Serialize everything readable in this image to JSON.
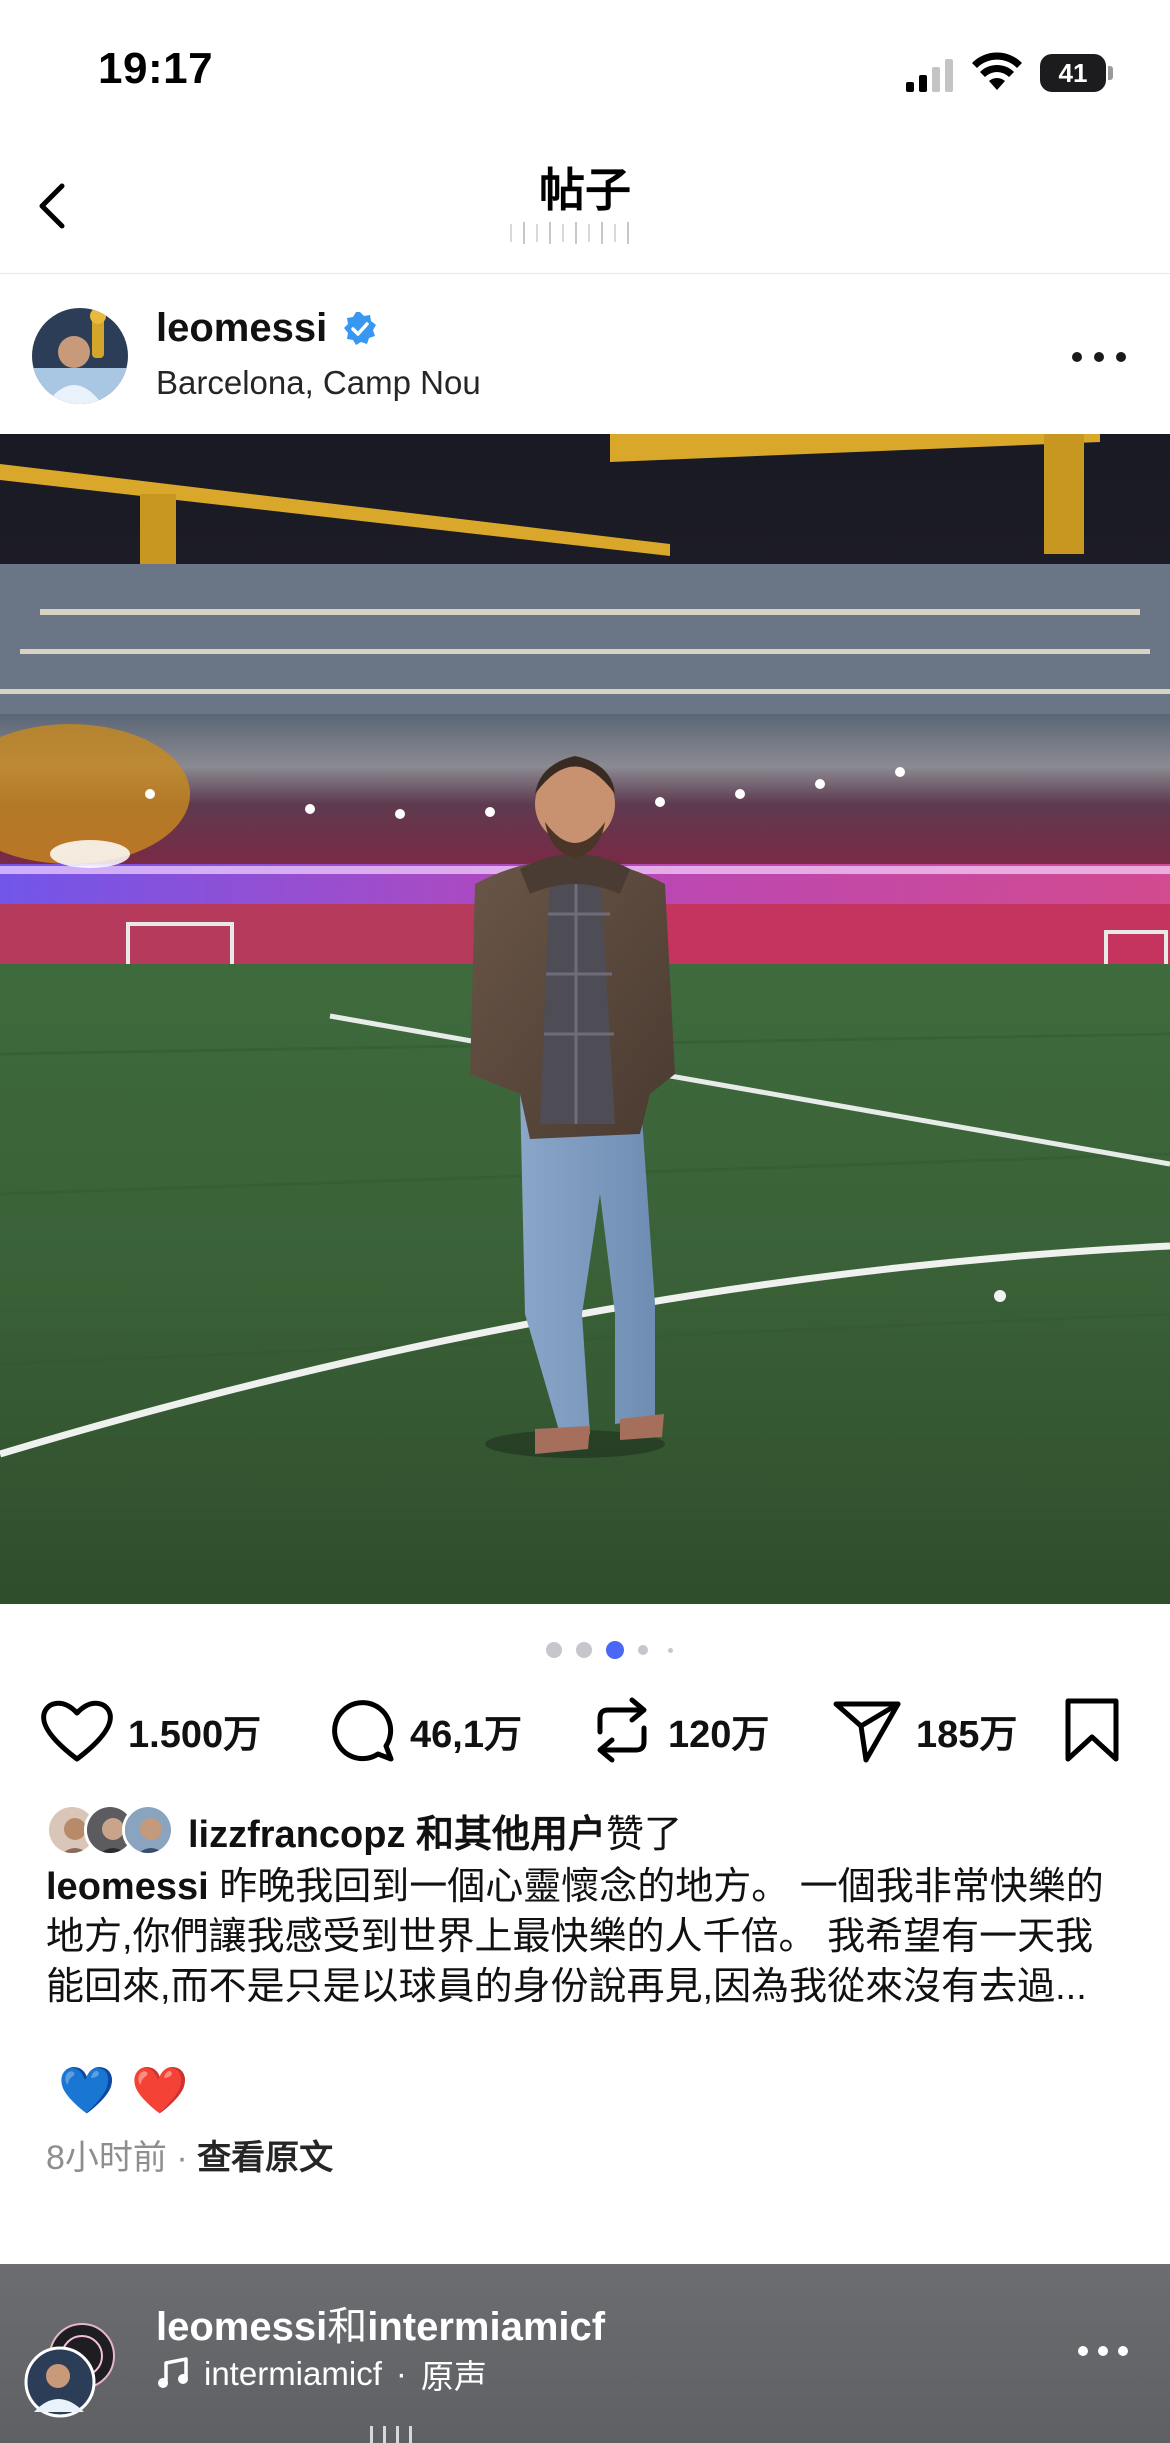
{
  "status_bar": {
    "time": "19:17",
    "battery": "41"
  },
  "header": {
    "title": "帖子"
  },
  "post": {
    "username": "leomessi",
    "location": "Barcelona, Camp Nou",
    "carousel": {
      "total": 5,
      "active": 3
    },
    "actions": {
      "likes": "1.500万",
      "comments": "46,1万",
      "reposts": "120万",
      "shares": "185万"
    },
    "liked_by": {
      "user": "lizzfrancopz",
      "suffix": "和其他用户",
      "verb": "赞了"
    },
    "caption": {
      "author": "leomessi",
      "text": "昨晚我回到一個心靈懷念的地方。 一個我非常快樂的地方,你們讓我感受到世界上最快樂的人千倍。 我希望有一天我能回來,而不是只是以球員的身份說再見,因為我從來沒有去過..."
    },
    "hearts": [
      "💙",
      "❤️"
    ],
    "time_ago": "8小时前",
    "separator": "·",
    "view_original": "查看原文"
  },
  "next_post": {
    "user1": "leomessi",
    "conj": "和",
    "user2": "intermiamicf",
    "audio_user": "intermiamicf",
    "audio_sep": "·",
    "audio_label": "原声"
  },
  "colors": {
    "verified": "#3897f0",
    "active_dot": "#4a67f5",
    "inactive_dot": "#c6c6cc",
    "text": "#111111",
    "meta": "#8e8e8e"
  },
  "icons": [
    "back-icon",
    "verified-icon",
    "more-icon",
    "heart-icon",
    "comment-icon",
    "repost-icon",
    "share-icon",
    "bookmark-icon",
    "music-icon"
  ]
}
